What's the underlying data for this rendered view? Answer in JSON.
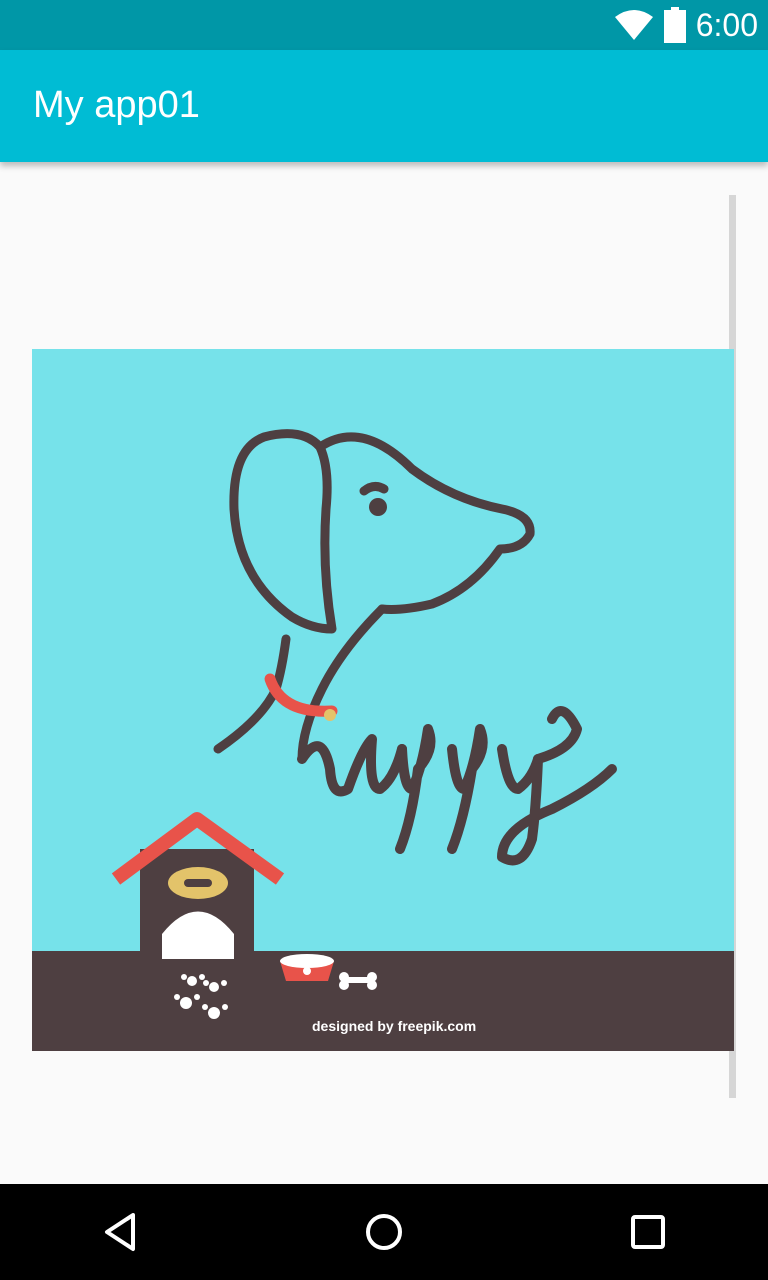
{
  "status_bar": {
    "time": "6:00",
    "wifi_icon": "wifi-icon",
    "battery_icon": "battery-icon"
  },
  "app_bar": {
    "title": "My app01"
  },
  "image": {
    "word": "uppy",
    "credit": "designed by freepik.com",
    "credit_prefix": "designed by",
    "credit_brand": "freepik.com"
  },
  "nav_bar": {
    "back_icon": "back-triangle-icon",
    "home_icon": "home-circle-icon",
    "recents_icon": "recents-square-icon"
  },
  "colors": {
    "status_bar": "#0097a7",
    "app_bar": "#00bcd4",
    "image_sky": "#76e2ea",
    "ground": "#4e3f41",
    "accent_red": "#e8534a"
  }
}
